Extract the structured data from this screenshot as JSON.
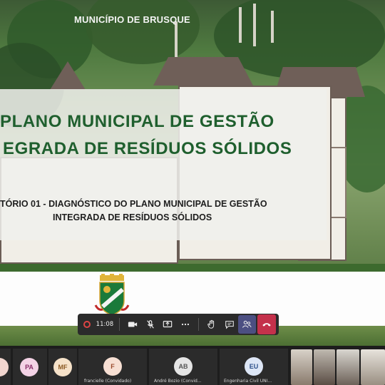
{
  "slide": {
    "municipality": "MUNICÍPIO DE BRUSQUE",
    "title_line1": "PLANO MUNICIPAL DE GESTÃO",
    "title_line2": "EGRADA DE RESÍDUOS SÓLIDOS",
    "subtitle_line1": "TÓRIO 01 - DIAGNÓSTICO DO PLANO MUNICIPAL DE GESTÃO",
    "subtitle_line2": "INTEGRADA DE RESÍDUOS SÓLIDOS"
  },
  "toolbar": {
    "time": "11:08",
    "icons": [
      "record-icon",
      "camera-icon",
      "mic-off-icon",
      "share-icon",
      "more-icon",
      "raise-hand-icon",
      "chat-icon",
      "people-icon",
      "hang-up-icon"
    ]
  },
  "participants": [
    {
      "initials": "",
      "bg": "#f2d6cf",
      "fg": "#9a4f3e",
      "name": ""
    },
    {
      "initials": "PA",
      "bg": "#f4d3e6",
      "fg": "#8a2f6a",
      "name": ""
    },
    {
      "initials": "MF",
      "bg": "#f6e2c9",
      "fg": "#8b5a22",
      "name": ""
    },
    {
      "initials": "F",
      "bg": "#f7dfd3",
      "fg": "#9a4a2c",
      "name": "francielle (Convidado)"
    },
    {
      "initials": "AB",
      "bg": "#e5e5e5",
      "fg": "#555555",
      "name": "André Bozio (Convid..."
    },
    {
      "initials": "EU",
      "bg": "#dde6f6",
      "fg": "#2c4f8a",
      "name": "Engenharia Civil UNI..."
    }
  ],
  "colors": {
    "title_green": "#1f5f2e",
    "toolbar_bg": "#2b2b2b",
    "hangup_red": "#c4314b",
    "people_active": "#4c4f82"
  }
}
